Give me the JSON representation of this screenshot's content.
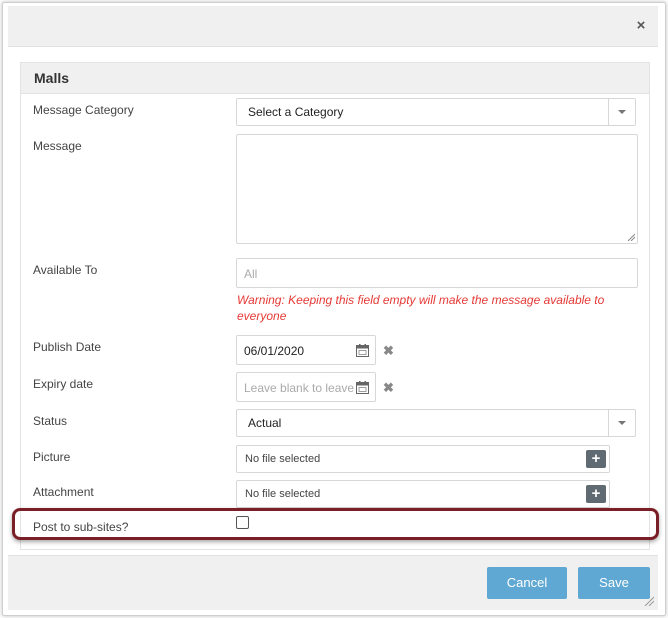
{
  "section": {
    "title": "Malls"
  },
  "fields": {
    "message_category": {
      "label": "Message Category",
      "value": "Select a Category"
    },
    "message": {
      "label": "Message"
    },
    "available_to": {
      "label": "Available To",
      "placeholder": "All",
      "warning": "Warning: Keeping this field empty will make the message available to everyone"
    },
    "publish_date": {
      "label": "Publish Date",
      "value": "06/01/2020"
    },
    "expiry_date": {
      "label": "Expiry date",
      "placeholder": "Leave blank to leave"
    },
    "status": {
      "label": "Status",
      "value": "Actual"
    },
    "picture": {
      "label": "Picture",
      "file_text": "No file selected"
    },
    "attachment": {
      "label": "Attachment",
      "file_text": "No file selected"
    },
    "post_to_subsites": {
      "label": "Post to sub-sites?",
      "checked": false
    }
  },
  "buttons": {
    "cancel": "Cancel",
    "save": "Save"
  },
  "icons": {
    "close": "close-icon",
    "calendar": "calendar-icon",
    "clear": "clear-icon",
    "add": "plus-icon",
    "dropdown": "chevron-down-icon"
  },
  "colors": {
    "primary_button": "#5fa8d3",
    "warning_text": "#e53935",
    "highlight_border": "#7a1f28",
    "add_button": "#5f6a72"
  }
}
